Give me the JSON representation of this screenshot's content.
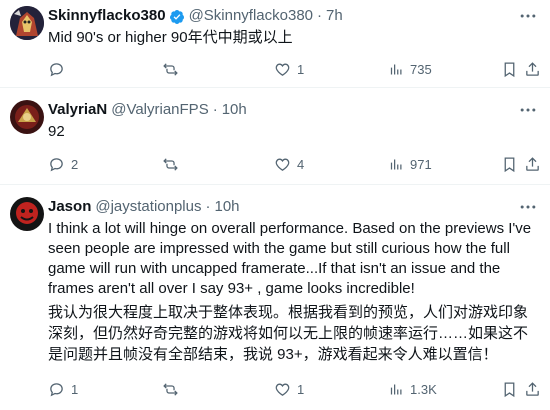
{
  "tweets": [
    {
      "name": "Skinnyflacko380",
      "verified": true,
      "handle": "@Skinnyflacko380",
      "sep": "·",
      "time": "7h",
      "text": "Mid 90's or higher 90年代中期或以上",
      "replies": "",
      "retweets": "",
      "likes": "1",
      "views": "735"
    },
    {
      "name": "ValyriaN",
      "verified": false,
      "handle": "@ValyrianFPS",
      "sep": "·",
      "time": "10h",
      "text": "92",
      "replies": "2",
      "retweets": "",
      "likes": "4",
      "views": "971"
    },
    {
      "name": "Jason",
      "verified": false,
      "handle": "@jaystationplus",
      "sep": "·",
      "time": "10h",
      "text": "I think a lot will hinge on overall performance.  Based on the previews I've seen people are impressed with the game but still curious how the full game will run with uncapped framerate...If that isn't an issue and the frames aren't all over I say 93+ , game looks incredible!",
      "translation": "我认为很大程度上取决于整体表现。根据我看到的预览，人们对游戏印象深刻，但仍然好奇完整的游戏将如何以无上限的帧速率运行……如果这不是问题并且帧没有全部结束，我说 93+，游戏看起来令人难以置信！",
      "replies": "1",
      "retweets": "",
      "likes": "1",
      "views": "1.3K"
    }
  ],
  "colors": {
    "verified": "#1d9bf0",
    "muted": "#536471",
    "text": "#0f1419",
    "divider": "#eff3f4"
  }
}
